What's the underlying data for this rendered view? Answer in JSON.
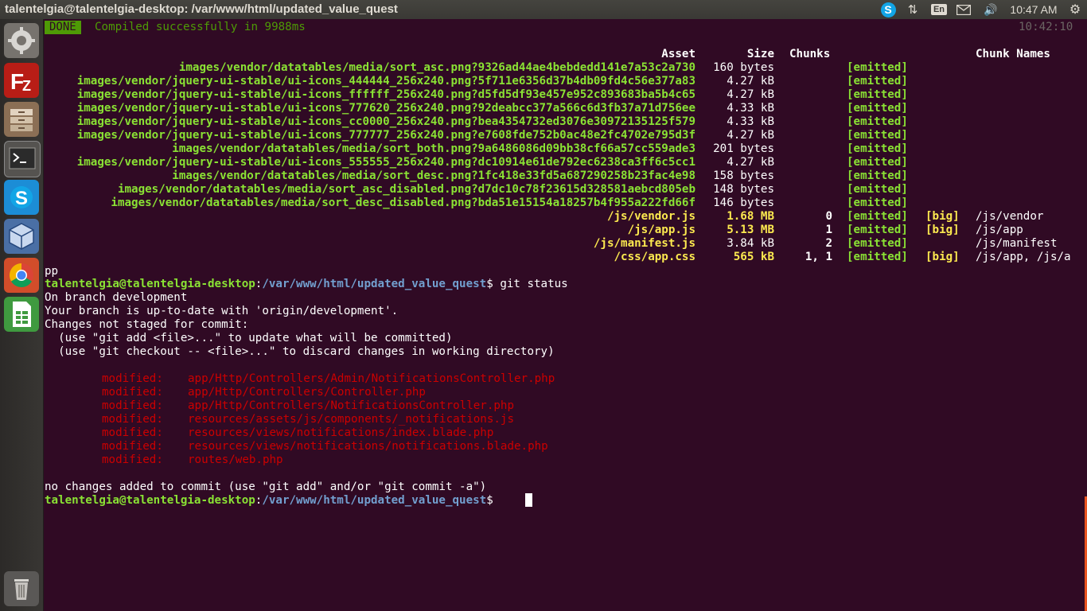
{
  "window_title": "talentelgia@talentelgia-desktop: /var/www/html/updated_value_quest",
  "panel": {
    "skype_label": "S",
    "network_glyph": "⇅",
    "keyboard_layout": "En",
    "volume_glyph": "🔊",
    "clock": "10:47 AM",
    "settings_glyph": "⚙"
  },
  "launcher": {
    "items": [
      {
        "name": "system-settings-icon"
      },
      {
        "name": "filezilla-icon"
      },
      {
        "name": "file-manager-icon"
      },
      {
        "name": "terminal-icon"
      },
      {
        "name": "skype-icon"
      },
      {
        "name": "virtualbox-icon"
      },
      {
        "name": "chrome-icon"
      },
      {
        "name": "spreadsheet-icon"
      },
      {
        "name": "trash-icon"
      }
    ]
  },
  "webpack": {
    "done_badge": "DONE",
    "compiled_message": "Compiled successfully in 9988ms",
    "build_time": "10:42:10",
    "headers": {
      "asset": "Asset",
      "size": "Size",
      "chunks": "Chunks",
      "chunk_names": "Chunk Names"
    },
    "rows": [
      {
        "asset": "images/vendor/datatables/media/sort_asc.png?9326ad44ae4bebdedd141e7a53c2a730",
        "size": "160 bytes",
        "chunks": "",
        "emitted": "[emitted]",
        "flag": "",
        "chunk_names": "",
        "kind": "image"
      },
      {
        "asset": "images/vendor/jquery-ui-stable/ui-icons_444444_256x240.png?5f711e6356d37b4db09fd4c56e377a83",
        "size": "4.27 kB",
        "chunks": "",
        "emitted": "[emitted]",
        "flag": "",
        "chunk_names": "",
        "kind": "image"
      },
      {
        "asset": "images/vendor/jquery-ui-stable/ui-icons_ffffff_256x240.png?d5fd5df93e457e952c893683ba5b4c65",
        "size": "4.27 kB",
        "chunks": "",
        "emitted": "[emitted]",
        "flag": "",
        "chunk_names": "",
        "kind": "image"
      },
      {
        "asset": "images/vendor/jquery-ui-stable/ui-icons_777620_256x240.png?92deabcc377a566c6d3fb37a71d756ee",
        "size": "4.33 kB",
        "chunks": "",
        "emitted": "[emitted]",
        "flag": "",
        "chunk_names": "",
        "kind": "image"
      },
      {
        "asset": "images/vendor/jquery-ui-stable/ui-icons_cc0000_256x240.png?bea4354732ed3076e30972135125f579",
        "size": "4.33 kB",
        "chunks": "",
        "emitted": "[emitted]",
        "flag": "",
        "chunk_names": "",
        "kind": "image"
      },
      {
        "asset": "images/vendor/jquery-ui-stable/ui-icons_777777_256x240.png?e7608fde752b0ac48e2fc4702e795d3f",
        "size": "4.27 kB",
        "chunks": "",
        "emitted": "[emitted]",
        "flag": "",
        "chunk_names": "",
        "kind": "image"
      },
      {
        "asset": "images/vendor/datatables/media/sort_both.png?9a6486086d09bb38cf66a57cc559ade3",
        "size": "201 bytes",
        "chunks": "",
        "emitted": "[emitted]",
        "flag": "",
        "chunk_names": "",
        "kind": "image"
      },
      {
        "asset": "images/vendor/jquery-ui-stable/ui-icons_555555_256x240.png?dc10914e61de792ec6238ca3ff6c5cc1",
        "size": "4.27 kB",
        "chunks": "",
        "emitted": "[emitted]",
        "flag": "",
        "chunk_names": "",
        "kind": "image"
      },
      {
        "asset": "images/vendor/datatables/media/sort_desc.png?1fc418e33fd5a687290258b23fac4e98",
        "size": "158 bytes",
        "chunks": "",
        "emitted": "[emitted]",
        "flag": "",
        "chunk_names": "",
        "kind": "image"
      },
      {
        "asset": "images/vendor/datatables/media/sort_asc_disabled.png?d7dc10c78f23615d328581aebcd805eb",
        "size": "148 bytes",
        "chunks": "",
        "emitted": "[emitted]",
        "flag": "",
        "chunk_names": "",
        "kind": "image"
      },
      {
        "asset": "images/vendor/datatables/media/sort_desc_disabled.png?bda51e15154a18257b4f955a222fd66f",
        "size": "146 bytes",
        "chunks": "",
        "emitted": "[emitted]",
        "flag": "",
        "chunk_names": "",
        "kind": "image"
      },
      {
        "asset": "/js/vendor.js",
        "size": "1.68 MB",
        "chunks": "0",
        "emitted": "[emitted]",
        "flag": "[big]",
        "chunk_names": "/js/vendor",
        "kind": "big"
      },
      {
        "asset": "/js/app.js",
        "size": "5.13 MB",
        "chunks": "1",
        "emitted": "[emitted]",
        "flag": "[big]",
        "chunk_names": "/js/app",
        "kind": "big"
      },
      {
        "asset": "/js/manifest.js",
        "size": "3.84 kB",
        "chunks": "2",
        "emitted": "[emitted]",
        "flag": "",
        "chunk_names": "/js/manifest",
        "kind": "small"
      },
      {
        "asset": "/css/app.css",
        "size": "565 kB",
        "chunks": "1, 1",
        "emitted": "[emitted]",
        "flag": "[big]",
        "chunk_names": "/js/app, /js/a",
        "kind": "big"
      }
    ],
    "wrap_tail": "pp"
  },
  "prompt": {
    "user_host": "talentelgia@talentelgia-desktop",
    "colon": ":",
    "path": "/var/www/html/updated_value_quest",
    "dollar": "$ "
  },
  "first_command": "git status",
  "git_status": {
    "lines": [
      "On branch development",
      "Your branch is up-to-date with 'origin/development'.",
      "Changes not staged for commit:",
      "  (use \"git add <file>...\" to update what will be committed)",
      "  (use \"git checkout -- <file>...\" to discard changes in working directory)"
    ],
    "modified_label": "modified:",
    "modified_files": [
      "app/Http/Controllers/Admin/NotificationsController.php",
      "app/Http/Controllers/Controller.php",
      "app/Http/Controllers/NotificationsController.php",
      "resources/assets/js/components/_notifications.js",
      "resources/views/notifications/index.blade.php",
      "resources/views/notifications/notifications.blade.php",
      "routes/web.php"
    ],
    "summary": "no changes added to commit (use \"git add\" and/or \"git commit -a\")"
  }
}
